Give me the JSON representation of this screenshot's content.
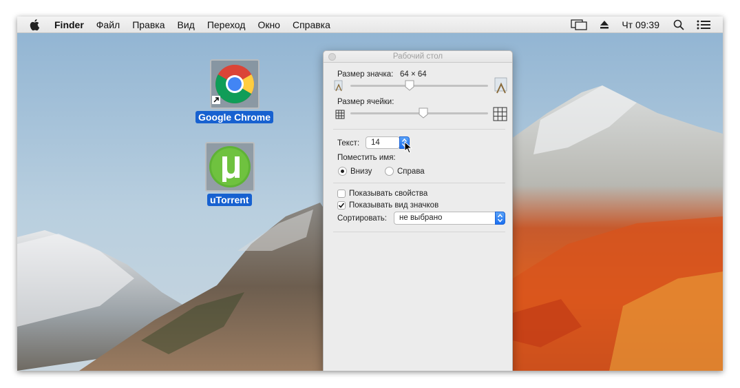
{
  "menubar": {
    "app_name": "Finder",
    "items": [
      "Файл",
      "Правка",
      "Вид",
      "Переход",
      "Окно",
      "Справка"
    ],
    "clock": "Чт 09:39",
    "tray_icons": [
      "display-mirroring-icon",
      "eject-icon",
      "spotlight-search-icon",
      "notification-center-icon"
    ]
  },
  "desktop": {
    "icons": [
      {
        "label": "Google Chrome",
        "icon": "chrome-icon",
        "selected": true
      },
      {
        "label": "uTorrent",
        "icon": "utorrent-icon",
        "selected": true
      }
    ]
  },
  "panel": {
    "title": "Рабочий стол",
    "icon_size_label": "Размер значка:",
    "icon_size_value": "64 × 64",
    "icon_size_slider": 0.43,
    "grid_spacing_label": "Размер ячейки:",
    "grid_spacing_slider": 0.53,
    "text_size_label": "Текст:",
    "text_size_value": "14",
    "label_position_label": "Поместить имя:",
    "label_position_options": [
      "Внизу",
      "Справа"
    ],
    "label_position_selected": "Внизу",
    "show_info_label": "Показывать свойства",
    "show_info_checked": false,
    "show_preview_label": "Показывать вид значков",
    "show_preview_checked": true,
    "sort_by_label": "Сортировать:",
    "sort_by_value": "не выбрано"
  },
  "colors": {
    "selection_blue": "#1761d0",
    "accent_blue": "#1b6ff0",
    "panel_bg": "#ececec"
  }
}
